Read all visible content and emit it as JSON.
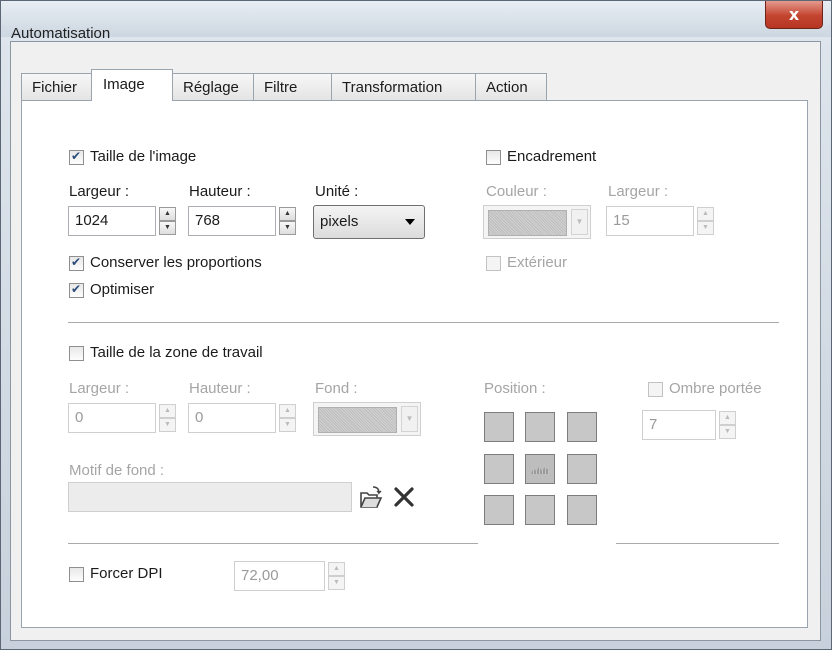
{
  "window": {
    "title": "Automatisation",
    "close_label": "x"
  },
  "tabs": [
    "Fichier",
    "Image",
    "Réglage",
    "Filtre",
    "Transformation",
    "Action"
  ],
  "image_size": {
    "label": "Taille de l'image",
    "checked": true,
    "width_label": "Largeur :",
    "width_value": "1024",
    "height_label": "Hauteur :",
    "height_value": "768",
    "unit_label": "Unité :",
    "unit_value": "pixels",
    "keep_ratio_label": "Conserver les proportions",
    "optimize_label": "Optimiser"
  },
  "frame": {
    "label": "Encadrement",
    "checked": false,
    "color_label": "Couleur :",
    "width_label": "Largeur :",
    "width_value": "15",
    "outside_label": "Extérieur"
  },
  "canvas": {
    "label": "Taille de la zone de travail",
    "checked": false,
    "width_label": "Largeur :",
    "width_value": "0",
    "height_label": "Hauteur :",
    "height_value": "0",
    "background_label": "Fond :",
    "position_label": "Position :",
    "shadow_label": "Ombre portée",
    "shadow_value": "7",
    "pattern_label": "Motif de fond :",
    "pattern_value": ""
  },
  "dpi": {
    "label": "Forcer DPI",
    "checked": false,
    "value": "72,00"
  },
  "icons": {
    "open": "folder-open-icon",
    "clear": "delete-x-icon"
  }
}
